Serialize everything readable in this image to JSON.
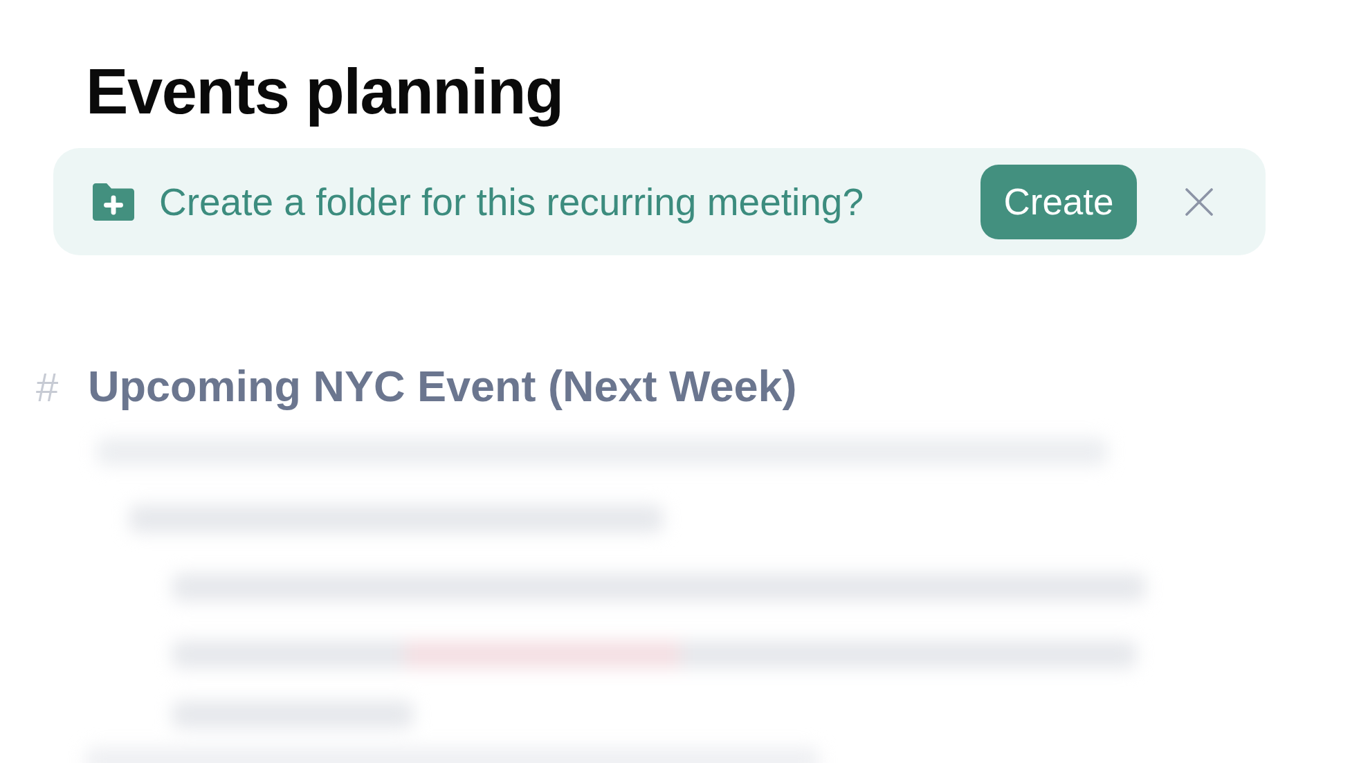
{
  "page": {
    "title": "Events planning"
  },
  "banner": {
    "message": "Create a folder for this recurring meeting?",
    "action": "Create"
  },
  "section": {
    "marker": "#",
    "heading": "Upcoming NYC Event (Next Week)"
  }
}
